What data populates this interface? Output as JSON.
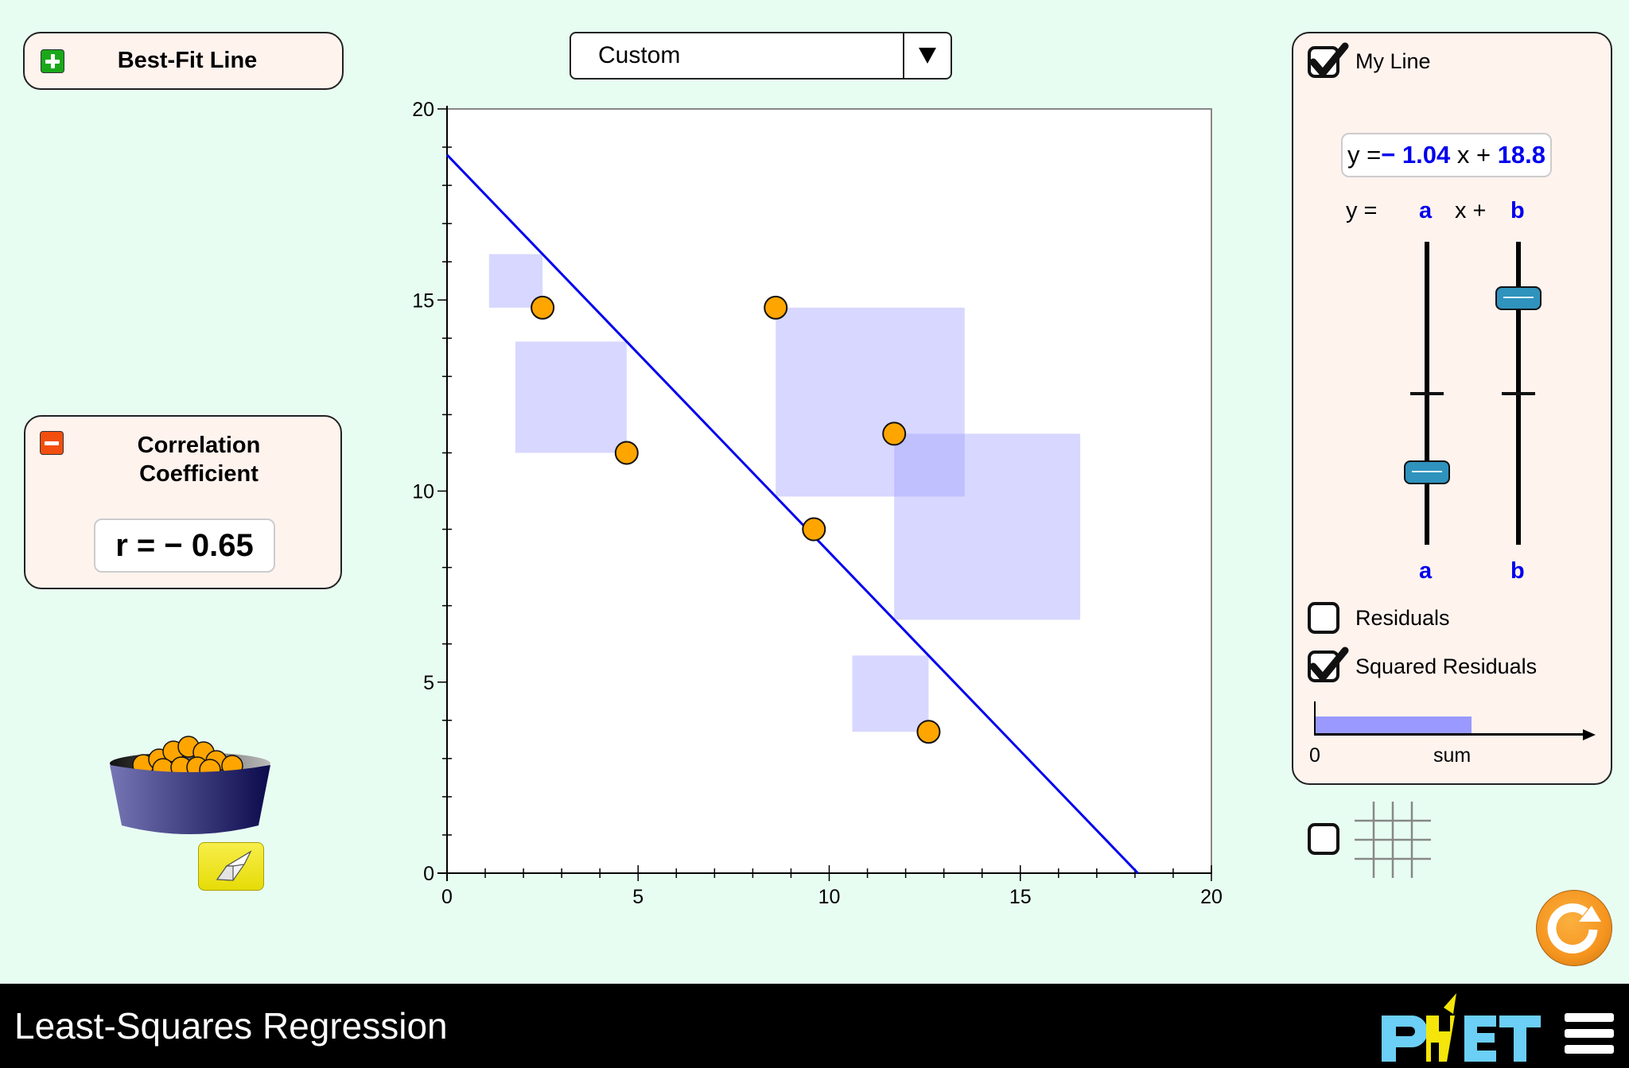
{
  "app": {
    "title": "Least-Squares Regression",
    "brand": "PhET"
  },
  "best_fit_panel": {
    "title": "Best-Fit Line",
    "expand_icon": "plus-icon",
    "expanded": false
  },
  "correlation_panel": {
    "title_line1": "Correlation",
    "title_line2": "Coefficient",
    "collapse_icon": "minus-icon",
    "expanded": true,
    "r_label": "r = − 0.65"
  },
  "dataset_selector": {
    "selected": "Custom",
    "arrow_icon": "triangle-down-icon"
  },
  "my_line_panel": {
    "my_line_label": "My Line",
    "my_line_checked": true,
    "equation": {
      "prefix": "y =",
      "a_text": "− 1.04",
      "mid": " x + ",
      "b_text": "18.8"
    },
    "template": {
      "y_eq": "y =",
      "a": "a",
      "x_plus": "x +",
      "b": "b"
    },
    "sliders": [
      {
        "name": "a",
        "label": "a",
        "value": -1.04,
        "min": -2,
        "max": 2
      },
      {
        "name": "b",
        "label": "b",
        "value": 18.8,
        "min": -30,
        "max": 30
      }
    ],
    "residuals_label": "Residuals",
    "residuals_checked": false,
    "squared_residuals_label": "Squared Residuals",
    "squared_residuals_checked": true,
    "sum_bar": {
      "zero_label": "0",
      "axis_label": "sum",
      "fraction": 0.56
    }
  },
  "grid_toggle": {
    "checked": false,
    "icon": "grid-icon"
  },
  "reset_button": {
    "icon": "reset-icon"
  },
  "bucket": {
    "icon": "bucket-icon"
  },
  "eraser_button": {
    "icon": "eraser-icon"
  },
  "colors": {
    "background": "#e8fdf2",
    "panel_fill": "#fff3ee",
    "line": "#0000ee",
    "point": "#ffa500",
    "square": "rgba(160,160,255,0.42)",
    "sum_bar": "#9999ff",
    "slider_thumb": "#2f93bd",
    "reset": "#f5951f",
    "phet_blue": "#6ccff6",
    "phet_yellow": "#f5e50a"
  },
  "chart_data": {
    "type": "scatter",
    "title": "",
    "xlabel": "",
    "ylabel": "",
    "xlim": [
      0,
      20
    ],
    "ylim": [
      0,
      20
    ],
    "x_ticks": [
      0,
      5,
      10,
      15,
      20
    ],
    "y_ticks": [
      0,
      5,
      10,
      15,
      20
    ],
    "minor_tick_step": 1,
    "grid": false,
    "points": [
      {
        "x": 2.5,
        "y": 14.8
      },
      {
        "x": 4.7,
        "y": 11.0
      },
      {
        "x": 8.6,
        "y": 14.8
      },
      {
        "x": 9.6,
        "y": 9.0
      },
      {
        "x": 11.7,
        "y": 11.5
      },
      {
        "x": 12.6,
        "y": 3.7
      }
    ],
    "line": {
      "slope": -1.04,
      "intercept": 18.8
    },
    "show_squared_residuals": true,
    "show_residuals": false
  }
}
